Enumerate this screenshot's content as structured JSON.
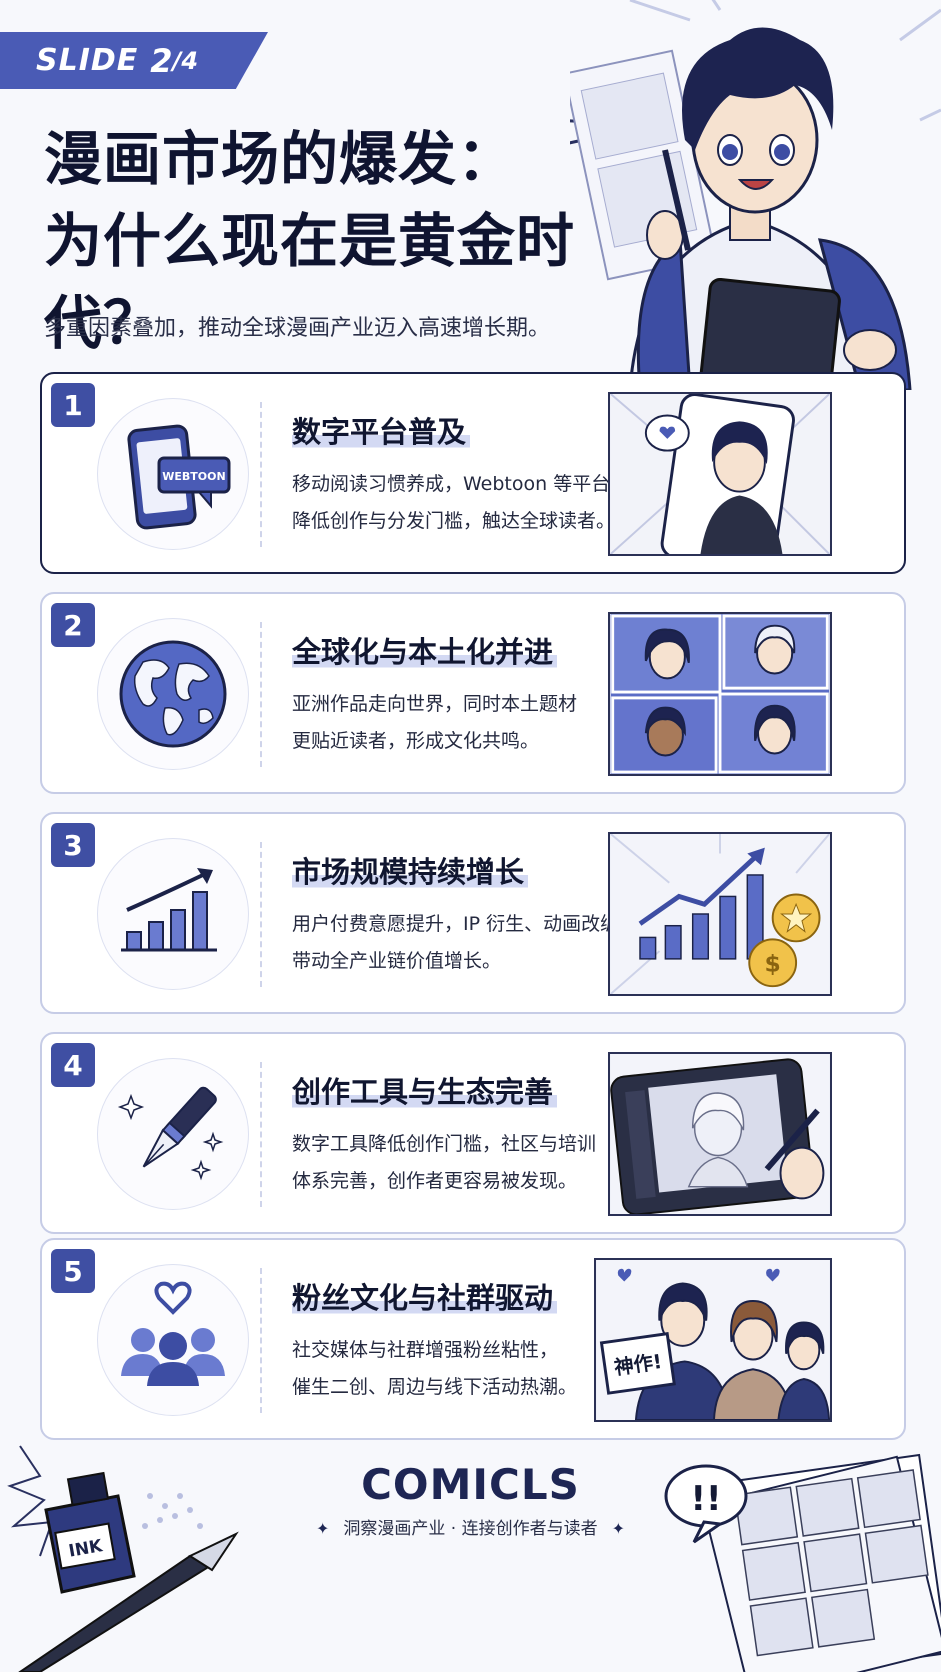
{
  "header": {
    "slide_label": "SLIDE",
    "slide_current": "2",
    "slide_total": "/4",
    "title_line1": "漫画市场的爆发：",
    "title_line2": "为什么现在是黄金时代？",
    "subtitle": "多重因素叠加，推动全球漫画产业迈入高速增长期。"
  },
  "cards": [
    {
      "number": "1",
      "title": "数字平台普及",
      "desc_line1": "移动阅读习惯养成，Webtoon 等平台",
      "desc_line2": "降低创作与分发门槛，触达全球读者。",
      "icon": "smartphone-webtoon-icon",
      "badge_text": "WEBTOON"
    },
    {
      "number": "2",
      "title": "全球化与本土化并进",
      "desc_line1": "亚洲作品走向世界，同时本土题材",
      "desc_line2": "更贴近读者，形成文化共鸣。",
      "icon": "globe-icon"
    },
    {
      "number": "3",
      "title": "市场规模持续增长",
      "desc_line1": "用户付费意愿提升，IP 衍生、动画改编",
      "desc_line2": "带动全产业链价值增长。",
      "icon": "growth-chart-icon"
    },
    {
      "number": "4",
      "title": "创作工具与生态完善",
      "desc_line1": "数字工具降低创作门槛，社区与培训",
      "desc_line2": "体系完善，创作者更容易被发现。",
      "icon": "fountain-pen-icon"
    },
    {
      "number": "5",
      "title": "粉丝文化与社群驱动",
      "desc_line1": "社交媒体与社群增强粉丝粘性，",
      "desc_line2": "催生二创、周边与线下活动热潮。",
      "icon": "community-heart-icon",
      "sign_text": "神作!"
    }
  ],
  "footer": {
    "brand": "COMICLS",
    "tagline": "洞察漫画产业 · 连接创作者与读者",
    "ink_label": "INK",
    "exclaim": "!!"
  },
  "colors": {
    "accent": "#4a5bb5",
    "dark": "#141a35",
    "card_border": "#c6cce6"
  }
}
